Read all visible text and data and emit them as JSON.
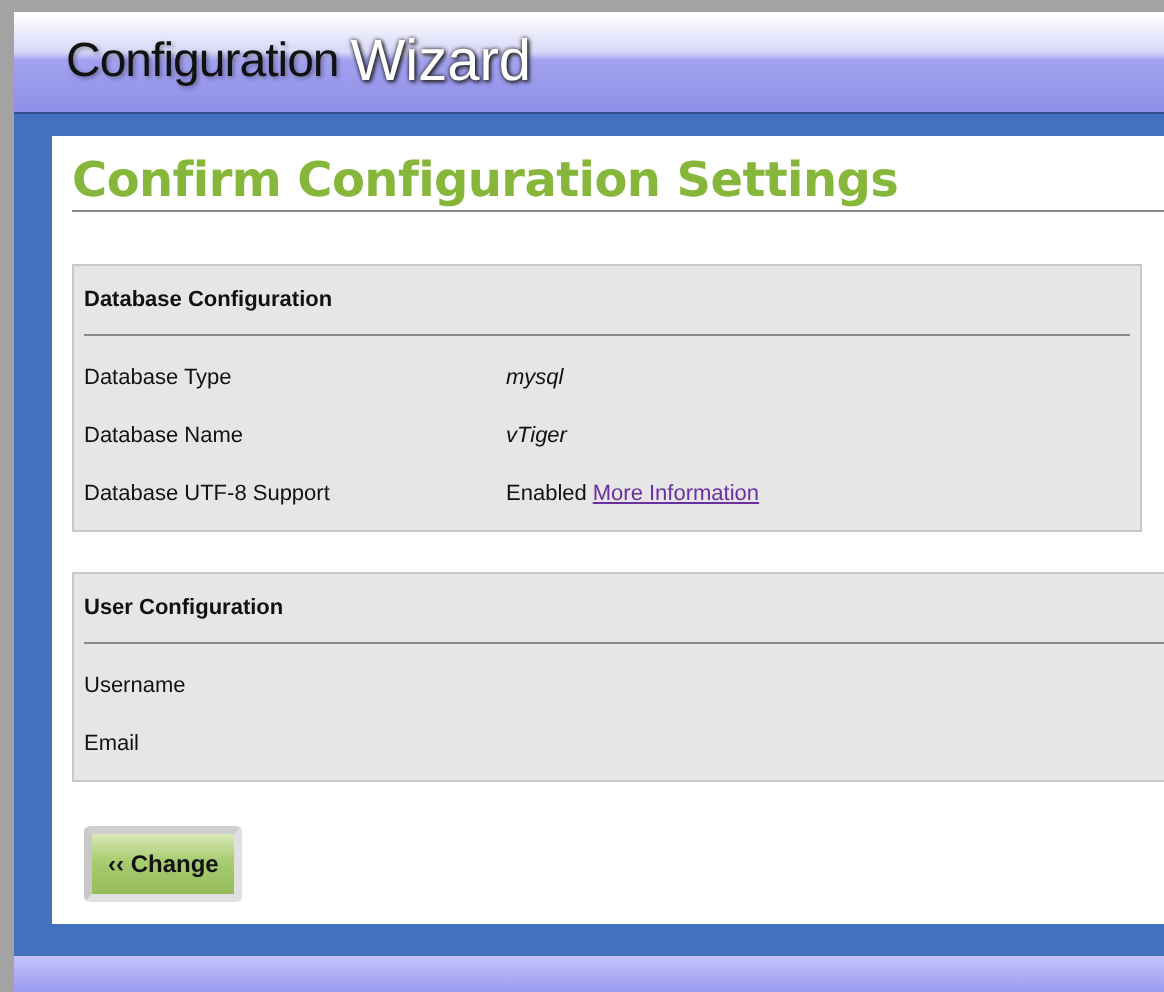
{
  "header": {
    "title_dark": "Configuration",
    "title_light": "Wizard"
  },
  "page_title": "Confirm Configuration Settings",
  "sections": [
    {
      "title": "Database Configuration",
      "rows": [
        {
          "label": "Database Type",
          "value": "mysql",
          "kind": "emphasis"
        },
        {
          "label": "Database Name",
          "value": "vTiger",
          "kind": "emphasis"
        },
        {
          "label": "Database UTF-8 Support",
          "value": "Enabled",
          "link": "More Information",
          "kind": "plain"
        }
      ]
    },
    {
      "title": "User Configuration",
      "rows": [
        {
          "label": "Username",
          "kind": "empty"
        },
        {
          "label": "Email",
          "kind": "empty"
        }
      ]
    }
  ],
  "buttons": [
    {
      "label": "‹‹ Change"
    }
  ]
}
